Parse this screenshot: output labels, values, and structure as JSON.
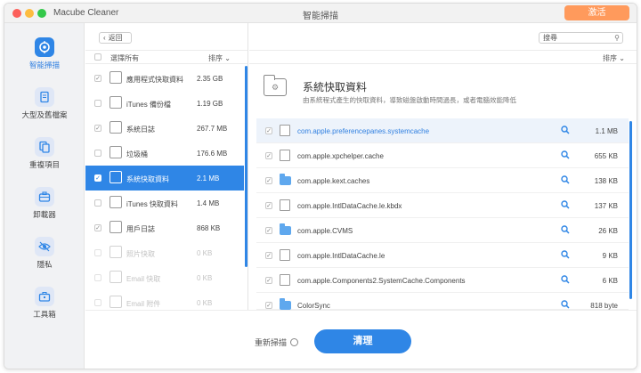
{
  "window": {
    "app_title": "Macube Cleaner",
    "title": "智能掃描",
    "activate_label": "激活"
  },
  "sidebar": {
    "items": [
      {
        "label": "智能掃描",
        "icon": "target-icon",
        "active": true
      },
      {
        "label": "大型及舊檔案",
        "icon": "document-icon",
        "active": false
      },
      {
        "label": "重複項目",
        "icon": "duplicate-icon",
        "active": false
      },
      {
        "label": "卸載器",
        "icon": "briefcase-icon",
        "active": false
      },
      {
        "label": "隱私",
        "icon": "eye-slash-icon",
        "active": false
      },
      {
        "label": "工具箱",
        "icon": "toolbox-icon",
        "active": false
      }
    ]
  },
  "list": {
    "back_label": "返回",
    "select_all_label": "選擇所有",
    "sort_label": "排序",
    "items": [
      {
        "name": "應用程式快取資料",
        "size": "2.35 GB",
        "checked": true,
        "state": "normal"
      },
      {
        "name": "iTunes 備份檔",
        "size": "1.19 GB",
        "checked": false,
        "state": "normal"
      },
      {
        "name": "系統日誌",
        "size": "267.7 MB",
        "checked": true,
        "state": "normal"
      },
      {
        "name": "垃圾桶",
        "size": "176.6 MB",
        "checked": false,
        "state": "normal"
      },
      {
        "name": "系統快取資料",
        "size": "2.1 MB",
        "checked": true,
        "state": "selected"
      },
      {
        "name": "iTunes 快取資料",
        "size": "1.4 MB",
        "checked": false,
        "state": "normal"
      },
      {
        "name": "用戶日誌",
        "size": "868 KB",
        "checked": true,
        "state": "normal"
      },
      {
        "name": "照片快取",
        "size": "0 KB",
        "checked": false,
        "state": "dim"
      },
      {
        "name": "Email 快取",
        "size": "0 KB",
        "checked": false,
        "state": "dim"
      },
      {
        "name": "Email 附件",
        "size": "0 KB",
        "checked": false,
        "state": "dim"
      }
    ]
  },
  "detail": {
    "search_placeholder": "搜尋",
    "sort_label": "排序",
    "title": "系統快取資料",
    "description": "由系統程式產生的快取資料，導致磁盤啟動時間過長，或者電腦效能降低",
    "rows": [
      {
        "name": "com.apple.preferencepanes.systemcache",
        "size": "1.1 MB",
        "type": "file"
      },
      {
        "name": "com.apple.xpchelper.cache",
        "size": "655 KB",
        "type": "file"
      },
      {
        "name": "com.apple.kext.caches",
        "size": "138 KB",
        "type": "folder"
      },
      {
        "name": "com.apple.IntlDataCache.le.kbdx",
        "size": "137 KB",
        "type": "file"
      },
      {
        "name": "com.apple.CVMS",
        "size": "26 KB",
        "type": "folder"
      },
      {
        "name": "com.apple.IntlDataCache.le",
        "size": "9 KB",
        "type": "file"
      },
      {
        "name": "com.apple.Components2.SystemCache.Components",
        "size": "6 KB",
        "type": "file"
      },
      {
        "name": "ColorSync",
        "size": "818 byte",
        "type": "folder"
      }
    ]
  },
  "footer": {
    "rescan_label": "重新掃描",
    "clean_label": "清理"
  },
  "colors": {
    "accent": "#2f86e6",
    "activate": "#ff9a5c"
  }
}
